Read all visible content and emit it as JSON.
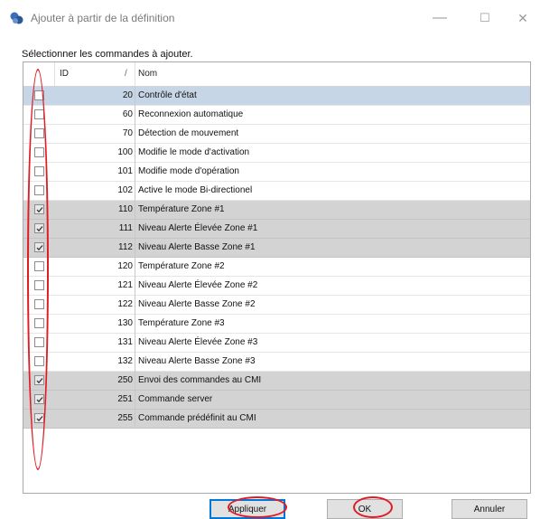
{
  "window": {
    "title": "Ajouter à partir de la définition",
    "minimize_glyph": "—",
    "maximize_glyph": "☐",
    "close_glyph": "✕"
  },
  "prompt": "Sélectionner les commandes à ajouter.",
  "table": {
    "columns": {
      "id": "ID",
      "sort_glyph": "/",
      "name": "Nom"
    },
    "rows": [
      {
        "id": "20",
        "name": "Contrôle d'état",
        "checked": false,
        "selected": false,
        "focused": true
      },
      {
        "id": "60",
        "name": "Reconnexion automatique",
        "checked": false,
        "selected": false
      },
      {
        "id": "70",
        "name": "Détection de mouvement",
        "checked": false,
        "selected": false
      },
      {
        "id": "100",
        "name": "Modifie le mode d'activation",
        "checked": false,
        "selected": false
      },
      {
        "id": "101",
        "name": "Modifie mode d'opération",
        "checked": false,
        "selected": false
      },
      {
        "id": "102",
        "name": "Active le mode Bi-directionel",
        "checked": false,
        "selected": false
      },
      {
        "id": "110",
        "name": "Température Zone #1",
        "checked": true,
        "selected": true
      },
      {
        "id": "111",
        "name": "Niveau Alerte Élevée Zone #1",
        "checked": true,
        "selected": true
      },
      {
        "id": "112",
        "name": "Niveau Alerte Basse Zone #1",
        "checked": true,
        "selected": true
      },
      {
        "id": "120",
        "name": "Température Zone #2",
        "checked": false,
        "selected": false
      },
      {
        "id": "121",
        "name": "Niveau Alerte Élevée Zone #2",
        "checked": false,
        "selected": false
      },
      {
        "id": "122",
        "name": "Niveau Alerte Basse Zone #2",
        "checked": false,
        "selected": false
      },
      {
        "id": "130",
        "name": "Température Zone #3",
        "checked": false,
        "selected": false
      },
      {
        "id": "131",
        "name": "Niveau Alerte Élevée Zone #3",
        "checked": false,
        "selected": false
      },
      {
        "id": "132",
        "name": "Niveau Alerte Basse Zone #3",
        "checked": false,
        "selected": false
      },
      {
        "id": "250",
        "name": "Envoi des commandes au CMI",
        "checked": true,
        "selected": true
      },
      {
        "id": "251",
        "name": "Commande server",
        "checked": true,
        "selected": true
      },
      {
        "id": "255",
        "name": "Commande prédéfinit au CMI",
        "checked": true,
        "selected": true
      }
    ]
  },
  "buttons": {
    "apply": "Appliquer",
    "ok": "OK",
    "cancel": "Annuler"
  },
  "colors": {
    "annotation": "#e01b24",
    "focused_row": "#c7d6e6",
    "selected_row": "#d3d3d3",
    "primary_border": "#0078d7"
  }
}
